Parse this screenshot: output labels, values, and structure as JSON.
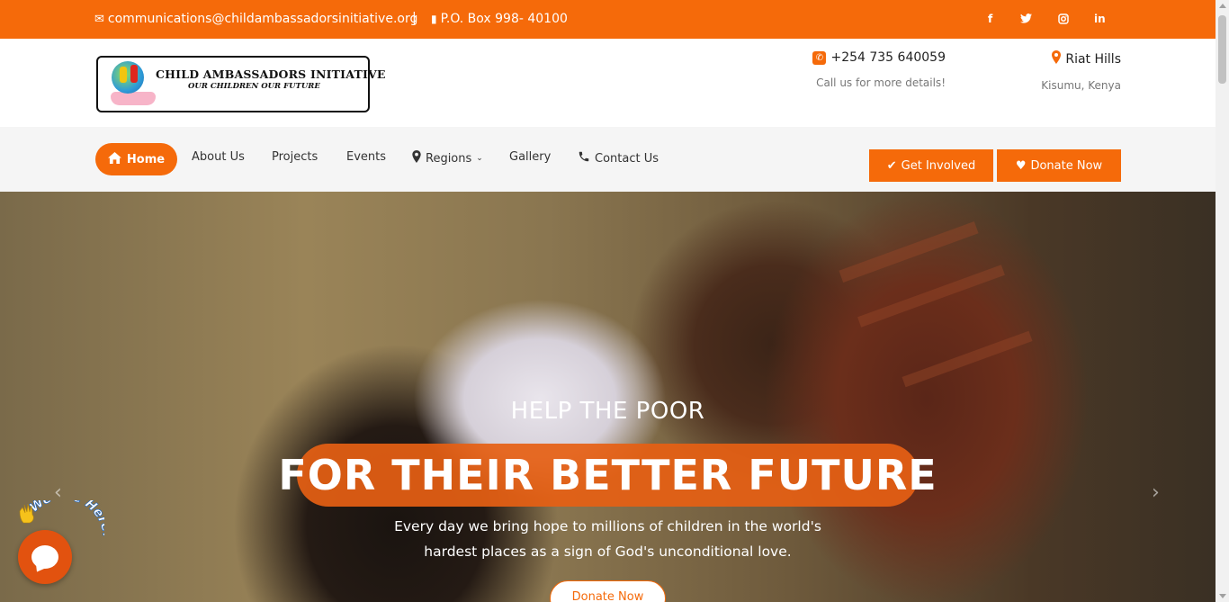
{
  "topbar": {
    "email": "communications@childambassadorsinitiative.org",
    "separator": "|",
    "pobox": "P.O. Box 998- 40100",
    "social": {
      "facebook": "f",
      "twitter": "🐦",
      "instagram": "◎",
      "linkedin": "in"
    }
  },
  "header": {
    "logo": {
      "name": "CHILD AMBASSADORS INITIATIVE",
      "tagline": "OUR CHILDREN OUR FUTURE"
    },
    "phone": {
      "number": "+254 735 640059",
      "note": "Call us for more details!"
    },
    "location": {
      "place": "Riat Hills",
      "city": "Kisumu, Kenya"
    }
  },
  "nav": {
    "items": [
      {
        "label": "Home"
      },
      {
        "label": "About Us"
      },
      {
        "label": "Projects"
      },
      {
        "label": "Events"
      },
      {
        "label": "Regions"
      },
      {
        "label": "Gallery"
      },
      {
        "label": "Contact Us"
      }
    ],
    "get_involved": "Get Involved",
    "donate": "Donate Now"
  },
  "hero": {
    "subtitle": "HELP THE POOR",
    "title": "FOR THEIR BETTER FUTURE",
    "description_line1": "Every day we bring hope to millions of children in the world's",
    "description_line2": "hardest places as a sign of God's unconditional love.",
    "donate_button": "Donate Now"
  },
  "chat": {
    "caption": "We Are Here!"
  },
  "colors": {
    "accent": "#f56a0a",
    "nav_bg": "#f5f5f5"
  }
}
